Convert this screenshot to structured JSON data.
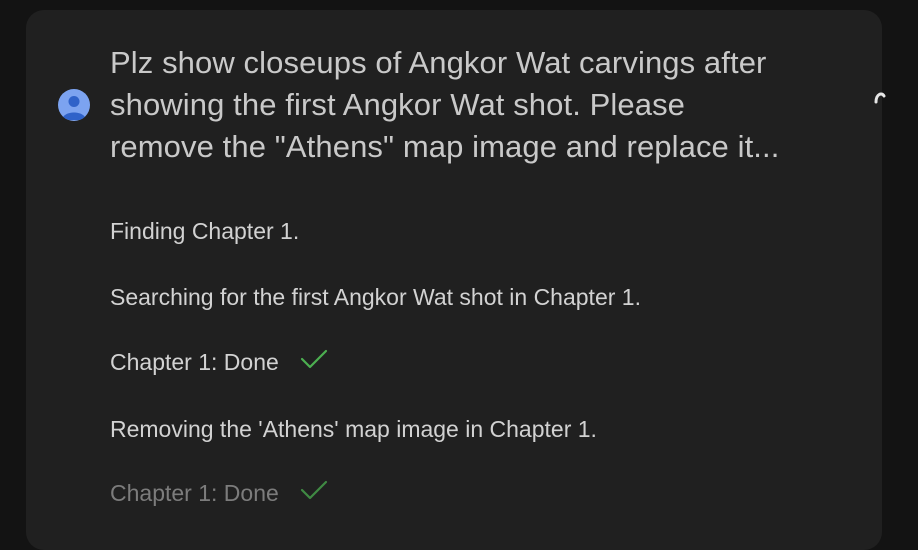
{
  "message": {
    "avatar_icon": "user-avatar-icon",
    "prompt_lines": [
      "Plz show closeups of Angkor Wat carvings after",
      "showing the first Angkor Wat shot. Please",
      "remove the \"Athens\" map image and replace it..."
    ]
  },
  "progress": {
    "steps": [
      {
        "text": "Finding Chapter 1.",
        "status": "in-progress"
      },
      {
        "text": "Searching for the first Angkor Wat shot in Chapter 1.",
        "status": "in-progress"
      },
      {
        "text": "Chapter 1: Done",
        "status": "done",
        "icon": "checkmark-icon"
      },
      {
        "text": "Removing the 'Athens' map image in Chapter 1.",
        "status": "in-progress"
      },
      {
        "text": "Chapter 1: Done",
        "status": "done",
        "icon": "checkmark-icon"
      }
    ]
  },
  "colors": {
    "background": "#131313",
    "panel": "#202020",
    "text": "#d2d2d2",
    "faded_text": "#7c7c7c",
    "check_green": "#4caf50",
    "avatar": "#7ca3f0"
  }
}
